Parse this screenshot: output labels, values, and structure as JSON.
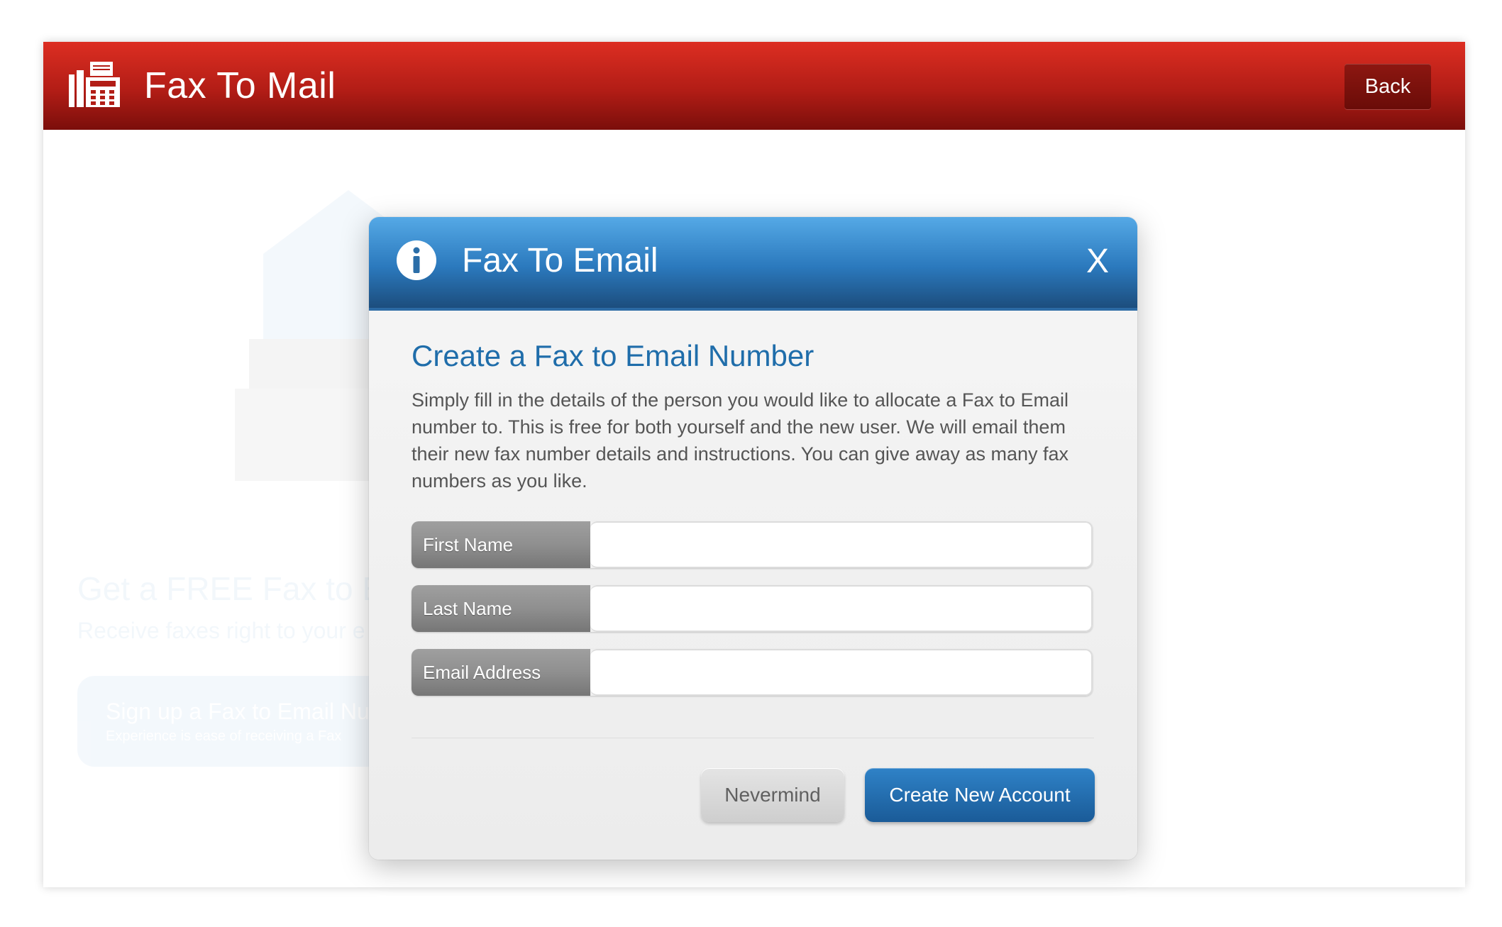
{
  "app": {
    "title": "Fax To Mail",
    "back_label": "Back",
    "logo_icon": "fax-machine-icon",
    "header_color": "#c8241b"
  },
  "background": {
    "heading": "Get a FREE Fax to Em",
    "subheading": "Receive faxes right to your e",
    "signup_title": "Sign up a Fax to Email Nu",
    "signup_subtitle": "Experience is ease of receiving a Fax"
  },
  "modal": {
    "title": "Fax To Email",
    "close_label": "X",
    "info_icon": "info-icon",
    "heading": "Create a Fax to Email Number",
    "description": "Simply fill in the details of the person you would like to allocate a Fax to Email number to. This is free for both yourself and the new user. We will email them their new fax number details and instructions. You can give away as many fax numbers as you like.",
    "header_color": "#2b79bd",
    "fields": [
      {
        "label": "First Name",
        "value": ""
      },
      {
        "label": "Last Name",
        "value": ""
      },
      {
        "label": "Email Address",
        "value": ""
      }
    ],
    "nevermind_label": "Nevermind",
    "create_label": "Create New Account"
  }
}
